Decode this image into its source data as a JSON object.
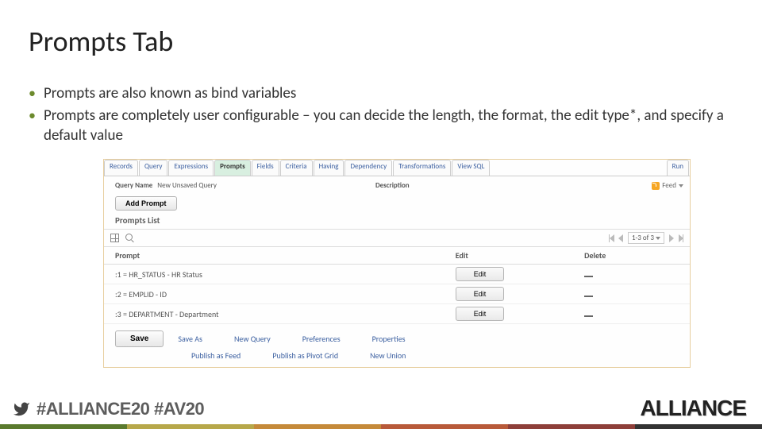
{
  "title": "Prompts Tab",
  "bullets": [
    "Prompts are also known as bind variables",
    "Prompts are completely user configurable – you can decide the length, the format, the  edit type*, and specify a default value"
  ],
  "shot": {
    "tabs": [
      "Records",
      "Query",
      "Expressions",
      "Prompts",
      "Fields",
      "Criteria",
      "Having",
      "Dependency",
      "Transformations",
      "View SQL",
      "Run"
    ],
    "activeTab": "Prompts",
    "queryNameLabel": "Query Name",
    "queryNameValue": "New Unsaved Query",
    "descriptionLabel": "Description",
    "feedLabel": "Feed",
    "addPromptLabel": "Add Prompt",
    "sectionTitle": "Prompts List",
    "pager": "1-3 of 3",
    "headers": {
      "prompt": "Prompt",
      "edit": "Edit",
      "delete": "Delete"
    },
    "rows": [
      {
        "label": ":1 = HR_STATUS - HR Status",
        "edit": "Edit"
      },
      {
        "label": ":2 = EMPLID - ID",
        "edit": "Edit"
      },
      {
        "label": ":3 = DEPARTMENT - Department",
        "edit": "Edit"
      }
    ],
    "save": "Save",
    "links1": [
      "Save As",
      "New Query",
      "Preferences",
      "Properties"
    ],
    "links2": [
      "Publish as Feed",
      "Publish as Pivot Grid",
      "New Union"
    ]
  },
  "footer": {
    "hashtags": "#ALLIANCE20 #AV20",
    "brand": "ALLIANCE"
  }
}
